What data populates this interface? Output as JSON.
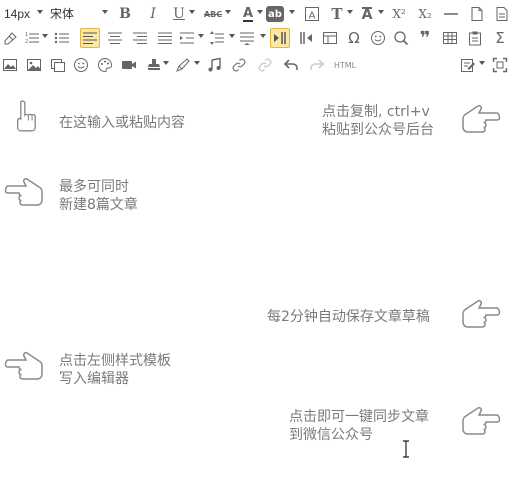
{
  "toolbar": {
    "font_size": "14px",
    "font_family": "宋体",
    "html_label": "HTML",
    "bold_label": "B",
    "italic_label": "I",
    "underline_label": "U",
    "strike_label": "ABC",
    "highlight_label": "ab",
    "fontcolor_label": "A",
    "paragraph_label": "T",
    "clearformat_label": "A",
    "superscript_label": "X²",
    "subscript_label": "X₂",
    "omega_label": "Ω",
    "sigma_label": "Σ",
    "quote_label": "❞"
  },
  "editor": {
    "tips": [
      {
        "lines": [
          "在这输入或粘贴内容"
        ]
      },
      {
        "lines": [
          "点击复制, ctrl+v",
          "粘贴到公众号后台"
        ]
      },
      {
        "lines": [
          "最多可同时",
          "新建8篇文章"
        ]
      },
      {
        "lines": [
          "每2分钟自动保存文章草稿"
        ]
      },
      {
        "lines": [
          "点击左侧样式模板",
          "写入编辑器"
        ]
      },
      {
        "lines": [
          "点击即可一键同步文章",
          "到微信公众号"
        ]
      }
    ]
  },
  "icons": {
    "hand_pointing_up": "hand-pointing-up-icon",
    "hand_pointing_right": "hand-pointing-right-icon",
    "hand_pointing_left": "hand-pointing-left-icon"
  }
}
